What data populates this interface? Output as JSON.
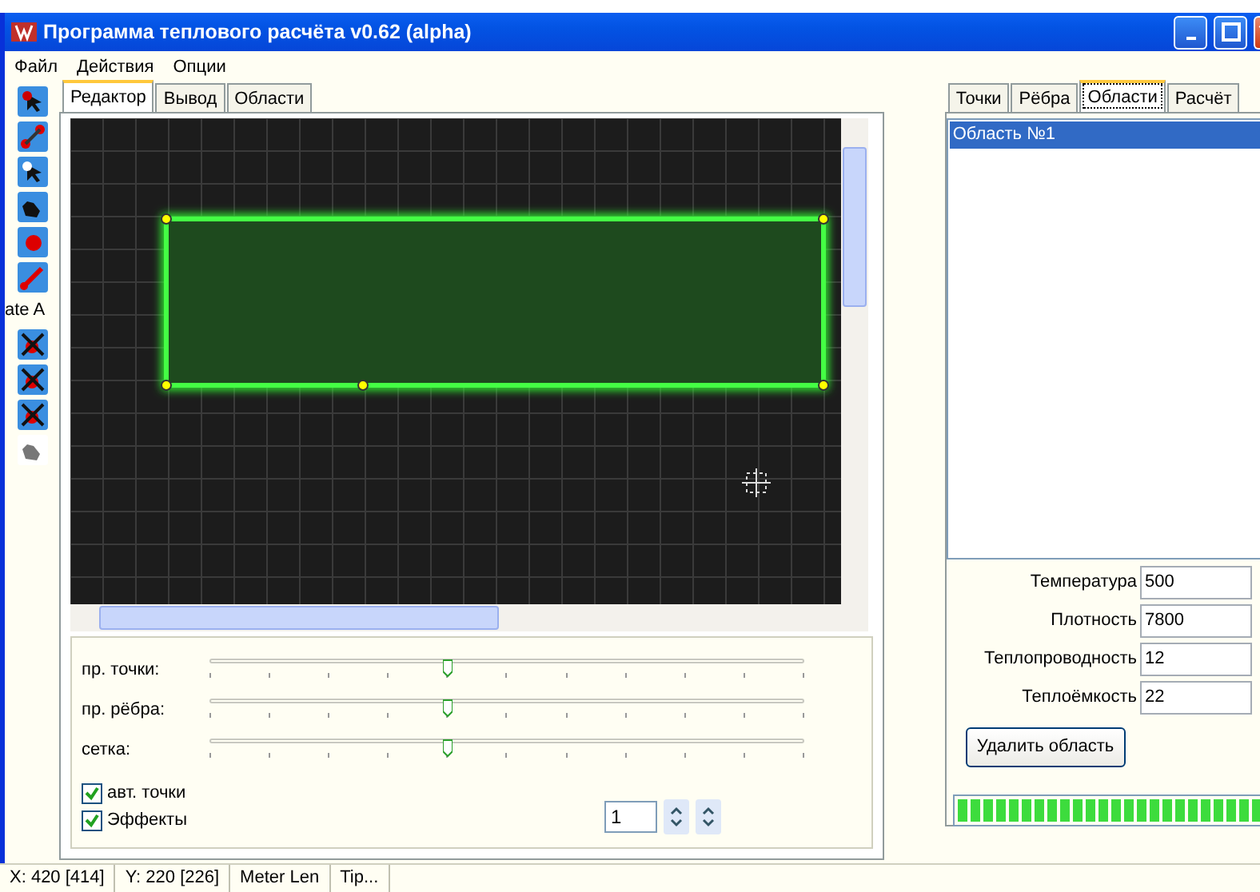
{
  "window": {
    "title": "Программа теплового расчёта v0.62 (alpha)"
  },
  "menu": [
    "Файл",
    "Действия",
    "Опции"
  ],
  "toolbar": {
    "cut_label": "ate A"
  },
  "editor_tabs": [
    {
      "label": "Редактор",
      "selected": true
    },
    {
      "label": "Вывод",
      "selected": false
    },
    {
      "label": "Области",
      "selected": false
    }
  ],
  "sliders": [
    {
      "label": "пр. точки:",
      "level": 0.4
    },
    {
      "label": "пр. рёбра:",
      "level": 0.4
    },
    {
      "label": "сетка:",
      "level": 0.4
    }
  ],
  "checkboxes": [
    {
      "label": "авт. точки",
      "checked": true
    },
    {
      "label": "Эффекты",
      "checked": true
    }
  ],
  "spin": {
    "value": "1"
  },
  "side_tabs": [
    {
      "label": "Точки",
      "selected": false
    },
    {
      "label": "Рёбра",
      "selected": false
    },
    {
      "label": "Области",
      "selected": true
    },
    {
      "label": "Расчёт",
      "selected": false
    }
  ],
  "regions": [
    {
      "label": "Область №1",
      "selected": true
    }
  ],
  "properties": [
    {
      "label": "Температура",
      "value": "500"
    },
    {
      "label": "Плотность",
      "value": "7800"
    },
    {
      "label": "Теплопроводность",
      "value": "12"
    },
    {
      "label": "Теплоёмкость",
      "value": "22"
    }
  ],
  "delete_button": "Удалить область",
  "progress": {
    "level": 1
  },
  "status_bar": [
    "X: 420 [414]",
    "Y: 220 [226]",
    "Meter Len",
    "Tip..."
  ]
}
